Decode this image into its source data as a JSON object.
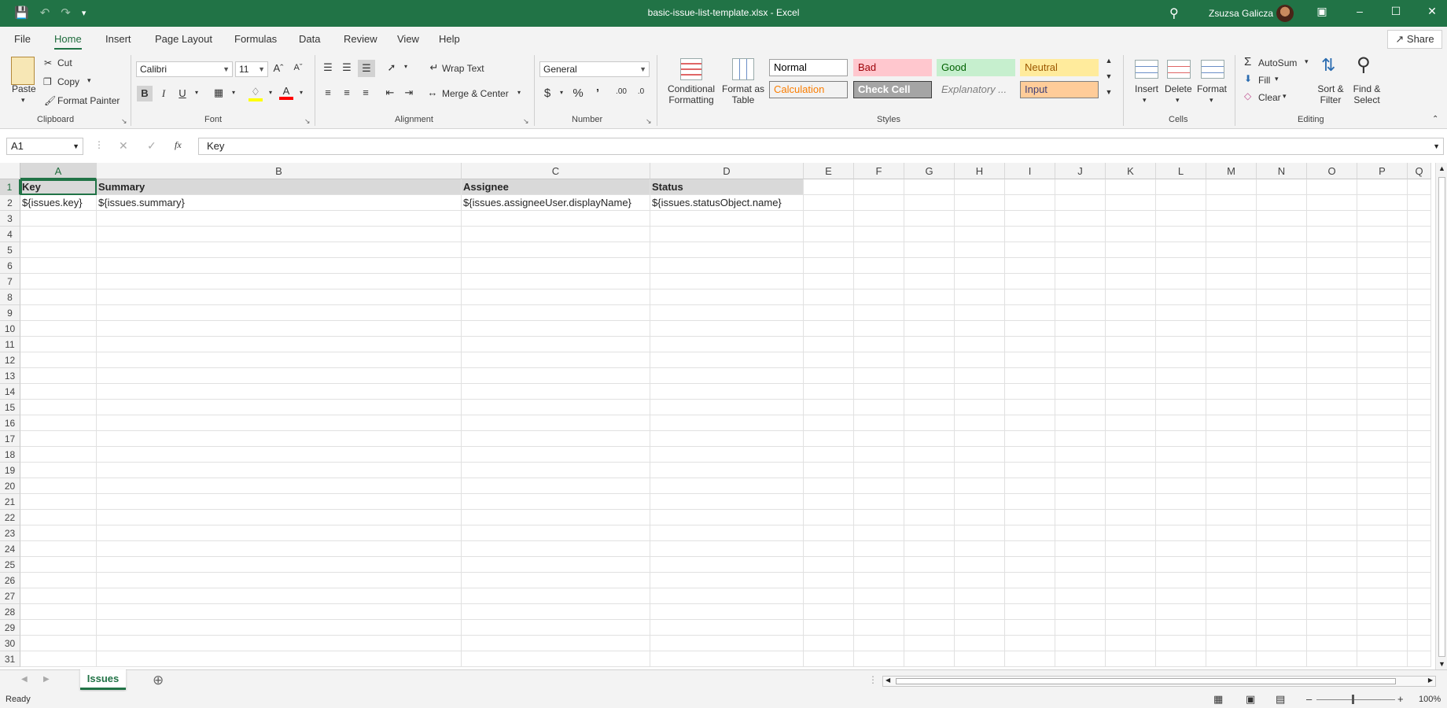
{
  "titlebar": {
    "title": "basic-issue-list-template.xlsx  -  Excel",
    "user": "Zsuzsa Galicza"
  },
  "tabs": [
    "File",
    "Home",
    "Insert",
    "Page Layout",
    "Formulas",
    "Data",
    "Review",
    "View",
    "Help"
  ],
  "share_label": "Share",
  "clipboard": {
    "paste": "Paste",
    "cut": "Cut",
    "copy": "Copy",
    "format_painter": "Format Painter",
    "label": "Clipboard"
  },
  "font": {
    "name": "Calibri",
    "size": "11",
    "label": "Font"
  },
  "alignment": {
    "wrap": "Wrap Text",
    "merge": "Merge & Center",
    "label": "Alignment"
  },
  "number": {
    "format": "General",
    "label": "Number"
  },
  "styles": {
    "conditional": "Conditional Formatting",
    "format_table": "Format as Table",
    "label": "Styles",
    "cells": [
      {
        "name": "Normal",
        "bg": "#ffffff",
        "color": "#000000",
        "border": "#a0a0a0"
      },
      {
        "name": "Bad",
        "bg": "#ffc7ce",
        "color": "#9c0006",
        "border": "transparent"
      },
      {
        "name": "Good",
        "bg": "#c6efce",
        "color": "#006100",
        "border": "transparent"
      },
      {
        "name": "Neutral",
        "bg": "#ffeb9c",
        "color": "#9c5700",
        "border": "transparent"
      },
      {
        "name": "Calculation",
        "bg": "#f2f2f2",
        "color": "#fa7d00",
        "border": "#7f7f7f"
      },
      {
        "name": "Check Cell",
        "bg": "#a5a5a5",
        "color": "#ffffff",
        "border": "#3f3f3f"
      },
      {
        "name": "Explanatory ...",
        "bg": "#f3f3f3",
        "color": "#7f7f7f",
        "border": "transparent"
      },
      {
        "name": "Input",
        "bg": "#ffcc99",
        "color": "#3f3f76",
        "border": "#7f7f7f"
      }
    ]
  },
  "cells_group": {
    "insert": "Insert",
    "delete": "Delete",
    "format": "Format",
    "label": "Cells"
  },
  "editing": {
    "autosum": "AutoSum",
    "fill": "Fill",
    "clear": "Clear",
    "sort": "Sort & Filter",
    "find": "Find & Select",
    "label": "Editing"
  },
  "formula_bar": {
    "name_box": "A1",
    "fx": "fx",
    "value": "Key"
  },
  "columns": [
    "A",
    "B",
    "C",
    "D",
    "E",
    "F",
    "G",
    "H",
    "I",
    "J",
    "K",
    "L",
    "M",
    "N",
    "O",
    "P",
    "Q"
  ],
  "rows": [
    "1",
    "2",
    "3",
    "4",
    "5",
    "6",
    "7",
    "8",
    "9",
    "10",
    "11",
    "12",
    "13",
    "14",
    "15",
    "16",
    "17",
    "18",
    "19",
    "20",
    "21",
    "22",
    "23",
    "24",
    "25",
    "26",
    "27",
    "28",
    "29",
    "30",
    "31"
  ],
  "sheet": {
    "headers": [
      "Key",
      "Summary",
      "Assignee",
      "Status"
    ],
    "row2": [
      "${issues.key}",
      "${issues.summary}",
      "${issues.assigneeUser.displayName}",
      "${issues.statusObject.name}"
    ]
  },
  "sheet_tab": "Issues",
  "status": {
    "ready": "Ready",
    "zoom": "100%"
  }
}
